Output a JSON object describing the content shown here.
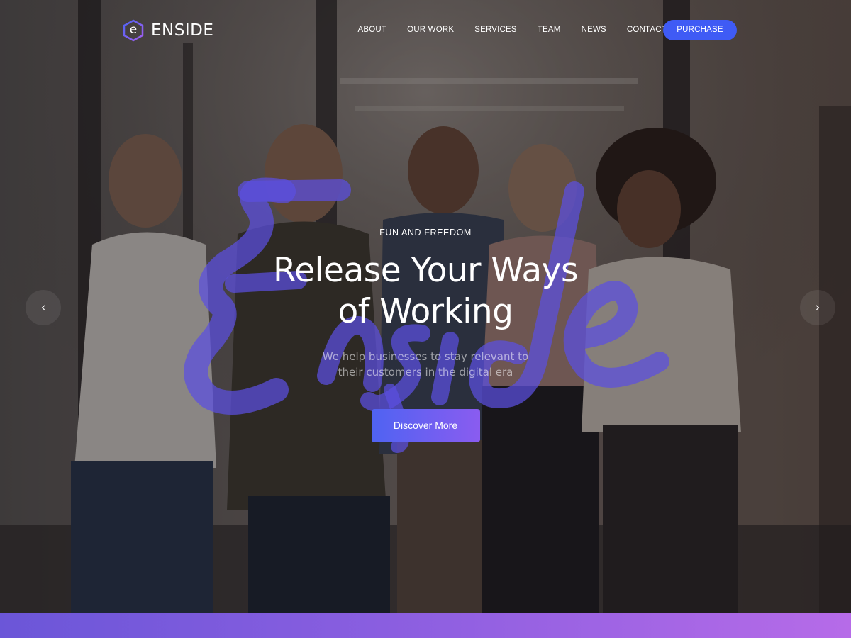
{
  "brand": {
    "logo_letter": "e",
    "name": "ENSIDE"
  },
  "nav": {
    "items": [
      {
        "label": "ABOUT"
      },
      {
        "label": "OUR WORK"
      },
      {
        "label": "SERVICES"
      },
      {
        "label": "TEAM"
      },
      {
        "label": "NEWS"
      },
      {
        "label": "CONTACT"
      }
    ],
    "purchase_label": "PURCHASE"
  },
  "hero": {
    "eyebrow": "FUN AND FREEDOM",
    "headline_line1": "Release Your Ways",
    "headline_line2": "of Working",
    "subtext": "We help businesses to stay relevant to their customers in the digital era",
    "cta_label": "Discover More",
    "watermark_word": "Enside"
  },
  "slider": {
    "prev_icon": "chevron-left-icon",
    "next_icon": "chevron-right-icon",
    "prev_glyph": "‹",
    "next_glyph": "›"
  },
  "colors": {
    "accent_blue": "#3f5bf5",
    "cta_gradient_start": "#4f63f2",
    "cta_gradient_end": "#8a5cf0",
    "band_start": "#6b56d8",
    "band_end": "#b66be8",
    "watermark": "#5b4fe0"
  }
}
